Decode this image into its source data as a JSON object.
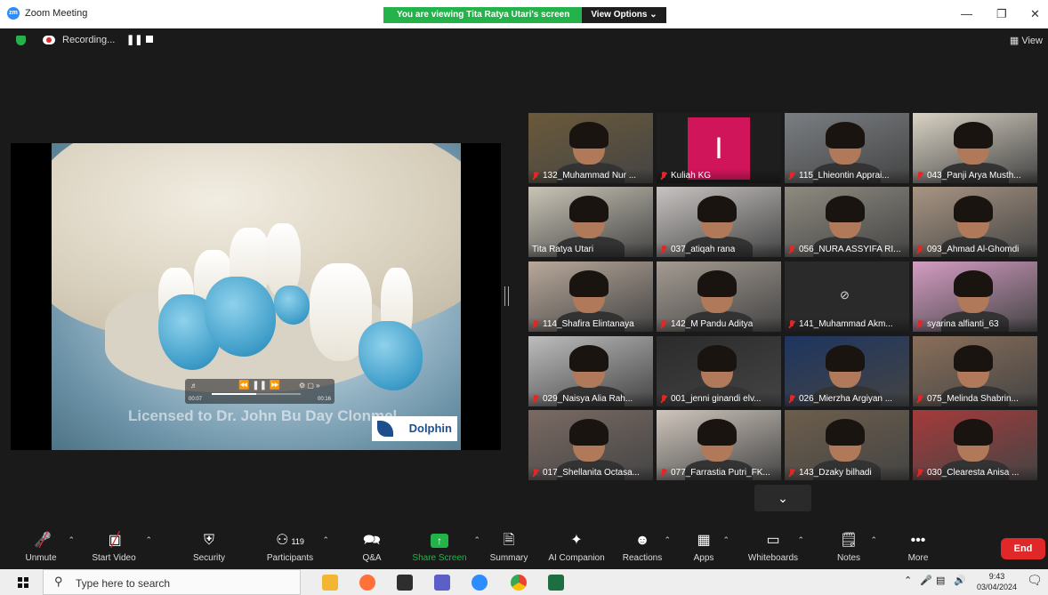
{
  "window": {
    "title": "Zoom Meeting",
    "banner_text": "You are viewing Tita Ratya Utari's screen",
    "view_options_label": "View Options"
  },
  "status": {
    "recording_label": "Recording...",
    "view_label": "View"
  },
  "share": {
    "video_watermark": "Licensed to Dr. John Bu   Day Clonmel",
    "brand": "Dolphin",
    "player_time_left": "00:07",
    "player_time_right": "00:16"
  },
  "participants": [
    {
      "name": "132_Muhammad Nur ...",
      "muted": true,
      "video": true,
      "bg": "#6b5a3a"
    },
    {
      "name": "Kuliah KG",
      "muted": true,
      "video": false,
      "initial": "I",
      "avatar_color": "#d0155a"
    },
    {
      "name": "115_Lhieontin Apprai...",
      "muted": true,
      "video": true,
      "bg": "#7a7e82"
    },
    {
      "name": "043_Panji Arya Musth...",
      "muted": true,
      "video": true,
      "bg": "#d9d2c4"
    },
    {
      "name": "Tita Ratya Utari",
      "muted": false,
      "video": true,
      "active": true,
      "bg": "#c9c4b6"
    },
    {
      "name": "037_atiqah rana",
      "muted": true,
      "video": true,
      "bg": "#c7c3c1"
    },
    {
      "name": "056_NURA ASSYIFA RI...",
      "muted": true,
      "video": true,
      "bg": "#8e8a80"
    },
    {
      "name": "093_Ahmad Al-Ghomdi",
      "muted": true,
      "video": true,
      "bg": "#a89583"
    },
    {
      "name": "114_Shafira Elintanaya",
      "muted": true,
      "video": true,
      "bg": "#b8a89a"
    },
    {
      "name": "142_M Pandu Aditya",
      "muted": true,
      "video": true,
      "bg": "#a49b92"
    },
    {
      "name": "141_Muhammad Akm...",
      "muted": true,
      "video": false,
      "icon": true
    },
    {
      "name": "syarina alfianti_63",
      "muted": true,
      "video": true,
      "bg": "#d49cc3"
    },
    {
      "name": "029_Naisya Alia Rah...",
      "muted": true,
      "video": true,
      "bg": "#bdbdbd"
    },
    {
      "name": "001_jenni ginandi elv...",
      "muted": true,
      "video": true,
      "bg": "#2b2b2b"
    },
    {
      "name": "026_Mierzha Argiyan ...",
      "muted": true,
      "video": true,
      "bg": "#1e3560"
    },
    {
      "name": "075_Melinda Shabrin...",
      "muted": true,
      "video": true,
      "bg": "#8a6f5a"
    },
    {
      "name": "017_Shellanita Octasa...",
      "muted": true,
      "video": true,
      "bg": "#7a6a63"
    },
    {
      "name": "077_Farrastia Putri_FK...",
      "muted": true,
      "video": true,
      "bg": "#cfc6bd"
    },
    {
      "name": "143_Dzaky bilhadi",
      "muted": true,
      "video": true,
      "bg": "#6d5e4c"
    },
    {
      "name": "030_Clearesta Anisa ...",
      "muted": true,
      "video": true,
      "bg": "#a63a3a"
    }
  ],
  "toolbar": {
    "unmute": "Unmute",
    "start_video": "Start Video",
    "security": "Security",
    "participants": "Participants",
    "participants_count": "119",
    "qa": "Q&A",
    "share_screen": "Share Screen",
    "summary": "Summary",
    "ai_companion": "AI Companion",
    "reactions": "Reactions",
    "apps": "Apps",
    "whiteboards": "Whiteboards",
    "notes": "Notes",
    "more": "More",
    "end": "End"
  },
  "taskbar": {
    "search_placeholder": "Type here to search",
    "time": "9:43",
    "date": "03/04/2024"
  },
  "colors": {
    "accent_green": "#24b24a",
    "end_red": "#e02828",
    "zoom_blue": "#2d8cff"
  }
}
